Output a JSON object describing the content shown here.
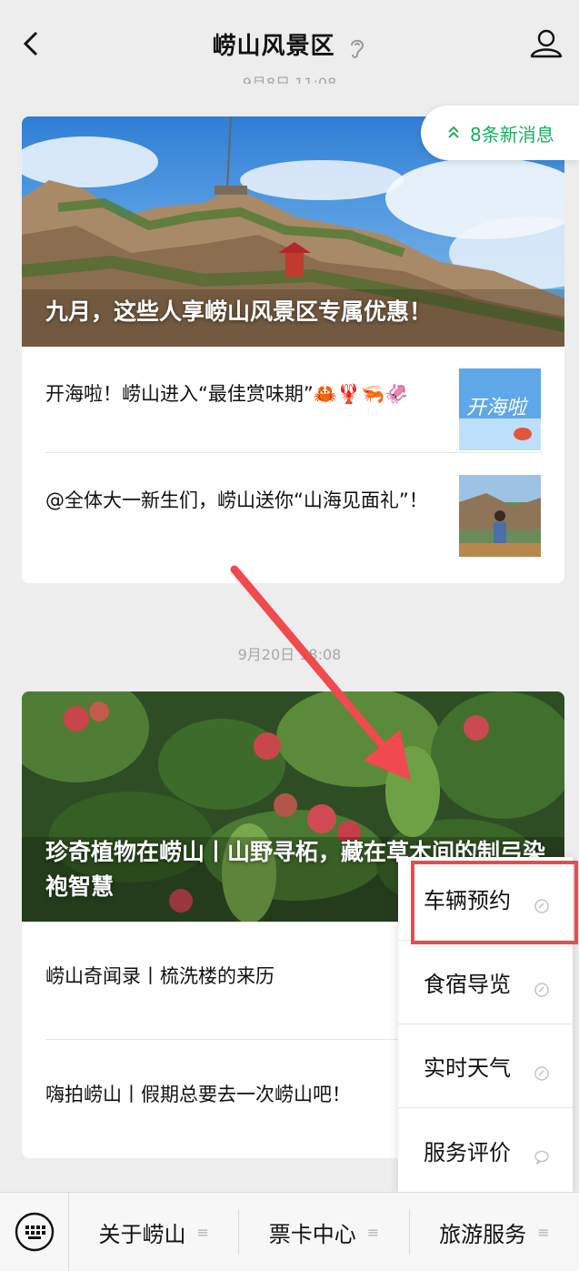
{
  "header": {
    "title": "崂山风景区",
    "prev_time": "9月8日 11:08"
  },
  "new_messages": "8条新消息",
  "feed": [
    {
      "hero_title": "九月，这些人享崂山风景区专属优惠！",
      "items": [
        {
          "text": "开海啦！崂山进入“最佳赏味期”🦀🦞🦐🦑",
          "thumb_text": "开海啦"
        },
        {
          "text": "@全体大一新生们，崂山送你“山海见面礼”！"
        }
      ]
    },
    {
      "time": "9月20日 18:08",
      "hero_title": "珍奇植物在崂山丨山野寻柘，藏在草木间的制弓染袍智慧",
      "items": [
        {
          "text": "崂山奇闻录丨梳洗楼的来历"
        },
        {
          "text": "嗨拍崂山丨假期总要去一次崂山吧！"
        }
      ]
    }
  ],
  "popup_menu": [
    {
      "label": "车辆预约",
      "icon": "link-icon"
    },
    {
      "label": "食宿导览",
      "icon": "link-icon"
    },
    {
      "label": "实时天气",
      "icon": "link-icon"
    },
    {
      "label": "服务评价",
      "icon": "chat-bubble-icon"
    }
  ],
  "bottom_tabs": [
    {
      "label": "关于崂山"
    },
    {
      "label": "票卡中心"
    },
    {
      "label": "旅游服务"
    }
  ],
  "colors": {
    "accent_green": "#1aad5f",
    "highlight_red": "#ea4b4b"
  }
}
